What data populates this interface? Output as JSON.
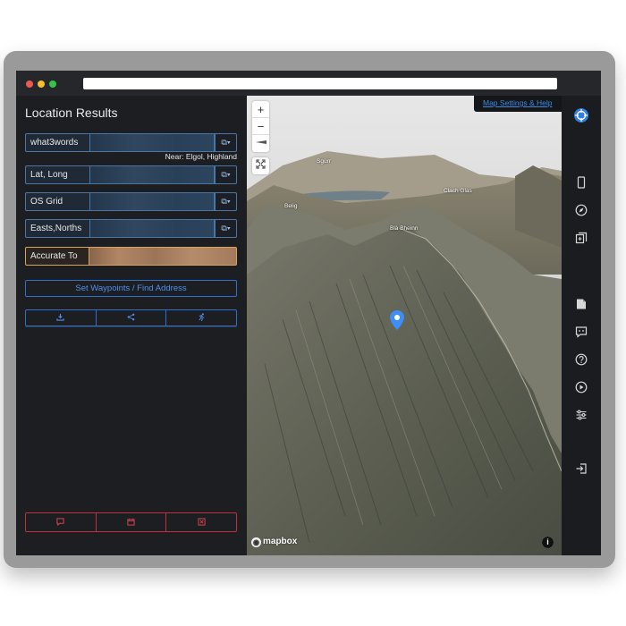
{
  "panel": {
    "title": "Location Results",
    "near_text": "Near: Elgol, Highland",
    "fields": [
      {
        "label": "what3words",
        "copy_icon": "copy-dropdown-icon"
      },
      {
        "label": "Lat, Long",
        "copy_icon": "copy-dropdown-icon"
      },
      {
        "label": "OS Grid",
        "copy_icon": "copy-dropdown-icon"
      },
      {
        "label": "Easts,Norths",
        "copy_icon": "copy-dropdown-icon"
      },
      {
        "label": "Accurate To"
      }
    ],
    "set_waypoints_label": "Set Waypoints / Find Address",
    "action_icons": [
      "download-icon",
      "share-icon",
      "running-icon"
    ],
    "footer_icons": [
      "comment-icon",
      "calendar-icon",
      "close-box-icon"
    ]
  },
  "map": {
    "settings_link": "Map Settings & Help",
    "places": [
      "Sgùrr",
      "Belig",
      "Blà Bheinn",
      "Clach Glas",
      "Beinn na Cro"
    ],
    "attribution": "mapbox",
    "zoom_in": "+",
    "zoom_out": "−"
  },
  "toolbar": {
    "icons": [
      "target-icon",
      "phone-icon",
      "compass-icon",
      "add-copy-icon",
      "note-icon",
      "feedback-icon",
      "help-icon",
      "play-icon",
      "sliders-icon",
      "logout-icon"
    ]
  },
  "colors": {
    "panel_bg": "#1d1e22",
    "field_border": "#4a76a4",
    "accurate_border": "#d6a55d",
    "accent_blue": "#2f6fd1",
    "danger_red": "#c0303a",
    "pin_blue": "#3d8ff5"
  }
}
